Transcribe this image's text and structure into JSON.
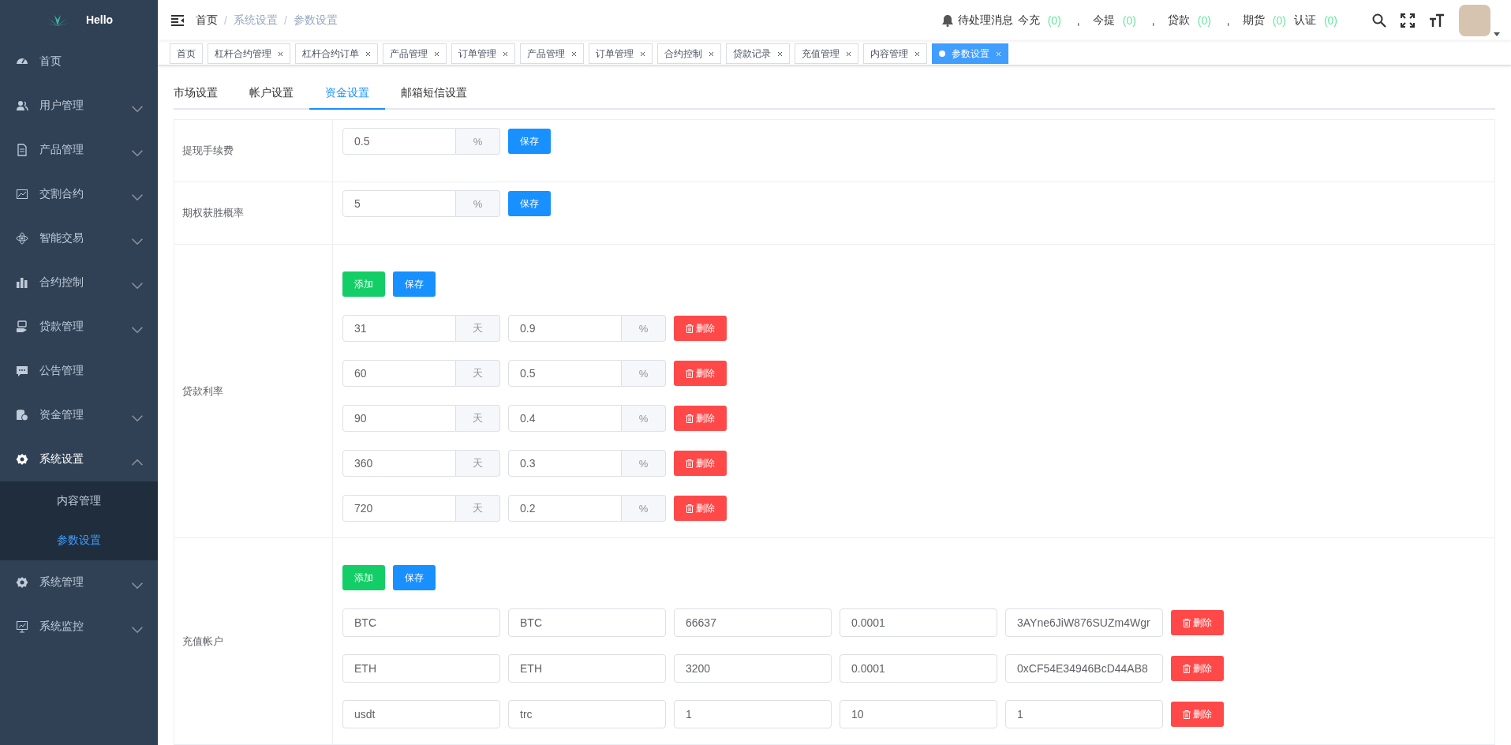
{
  "sidebar": {
    "logo": "Hello",
    "items": [
      {
        "label": "首页",
        "kind": "link"
      },
      {
        "label": "用户管理",
        "kind": "submenu",
        "expanded": false
      },
      {
        "label": "产品管理",
        "kind": "submenu",
        "expanded": false
      },
      {
        "label": "交割合约",
        "kind": "submenu",
        "expanded": false
      },
      {
        "label": "智能交易",
        "kind": "submenu",
        "expanded": false
      },
      {
        "label": "合约控制",
        "kind": "submenu",
        "expanded": false
      },
      {
        "label": "贷款管理",
        "kind": "submenu",
        "expanded": false
      },
      {
        "label": "公告管理",
        "kind": "link"
      },
      {
        "label": "资金管理",
        "kind": "submenu",
        "expanded": false
      },
      {
        "label": "系统设置",
        "kind": "submenu",
        "expanded": true,
        "children": [
          {
            "label": "内容管理",
            "selected": false
          },
          {
            "label": "参数设置",
            "selected": true
          }
        ]
      },
      {
        "label": "系统管理",
        "kind": "submenu",
        "expanded": false
      },
      {
        "label": "系统监控",
        "kind": "submenu",
        "expanded": false
      }
    ]
  },
  "header": {
    "breadcrumbs": [
      {
        "label": "首页"
      },
      {
        "label": "系统设置",
        "separator": "/"
      },
      {
        "label": "参数设置",
        "separator": "/"
      }
    ],
    "notifications": {
      "label": "待处理消息",
      "counters": [
        {
          "label": "今充",
          "count": "(0)",
          "separator": ","
        },
        {
          "label": "今提",
          "count": "(0)",
          "separator": ","
        },
        {
          "label": "贷款",
          "count": "(0)",
          "separator": ","
        },
        {
          "label": "期货",
          "count": "(0)"
        },
        {
          "label": "认证",
          "count": "(0)"
        }
      ]
    }
  },
  "tags": [
    {
      "label": "首页",
      "closable": false,
      "selected": false
    },
    {
      "label": "杠杆合约管理",
      "closable": true,
      "selected": false
    },
    {
      "label": "杠杆合约订单",
      "closable": true,
      "selected": false
    },
    {
      "label": "产品管理",
      "closable": true,
      "selected": false
    },
    {
      "label": "订单管理",
      "closable": true,
      "selected": false
    },
    {
      "label": "产品管理",
      "closable": true,
      "selected": false
    },
    {
      "label": "订单管理",
      "closable": true,
      "selected": false
    },
    {
      "label": "合约控制",
      "closable": true,
      "selected": false
    },
    {
      "label": "贷款记录",
      "closable": true,
      "selected": false
    },
    {
      "label": "充值管理",
      "closable": true,
      "selected": false
    },
    {
      "label": "内容管理",
      "closable": true,
      "selected": false
    },
    {
      "label": "参数设置",
      "closable": true,
      "selected": true
    }
  ],
  "settings_tabs": [
    {
      "label": "市场设置",
      "selected": false
    },
    {
      "label": "帐户设置",
      "selected": false
    },
    {
      "label": "资金设置",
      "selected": true
    },
    {
      "label": "邮箱短信设置",
      "selected": false
    }
  ],
  "settings_rows": [
    {
      "kind": "single",
      "label": "提现手续费",
      "value": "0.5",
      "unit": "%",
      "button": "保存"
    },
    {
      "kind": "single",
      "label": "期权获胜概率",
      "value": "5",
      "unit": "%",
      "button": "保存"
    },
    {
      "kind": "rates",
      "label": "贷款利率",
      "actions": [
        {
          "label": "添加",
          "kind": "success"
        },
        {
          "label": "保存",
          "kind": "primary"
        }
      ],
      "entries": [
        {
          "days": "31",
          "days_unit": "天",
          "rate": "0.9",
          "rate_unit": "%",
          "delete": "删除"
        },
        {
          "days": "60",
          "days_unit": "天",
          "rate": "0.5",
          "rate_unit": "%",
          "delete": "删除"
        },
        {
          "days": "90",
          "days_unit": "天",
          "rate": "0.4",
          "rate_unit": "%",
          "delete": "删除"
        },
        {
          "days": "360",
          "days_unit": "天",
          "rate": "0.3",
          "rate_unit": "%",
          "delete": "删除"
        },
        {
          "days": "720",
          "days_unit": "天",
          "rate": "0.2",
          "rate_unit": "%",
          "delete": "删除"
        }
      ]
    },
    {
      "kind": "accounts",
      "label": "充值帐户",
      "actions": [
        {
          "label": "添加",
          "kind": "success"
        },
        {
          "label": "保存",
          "kind": "primary"
        }
      ],
      "entries": [
        {
          "fields": [
            "BTC",
            "BTC",
            "66637",
            "0.0001",
            "3AYne6JiW876SUZm4Wgr"
          ],
          "delete": "删除"
        },
        {
          "fields": [
            "ETH",
            "ETH",
            "3200",
            "0.0001",
            "0xCF54E34946BcD44AB8"
          ],
          "delete": "删除"
        },
        {
          "fields": [
            "usdt",
            "trc",
            "1",
            "10",
            "1"
          ],
          "delete": "删除"
        }
      ]
    }
  ]
}
